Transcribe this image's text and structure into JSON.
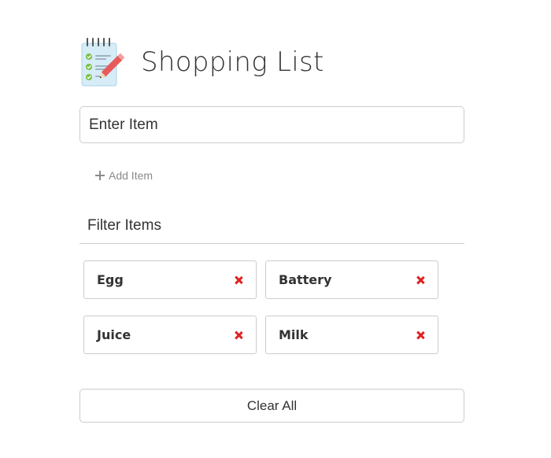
{
  "app": {
    "title": "Shopping List",
    "logo_icon": "notepad-checklist-icon"
  },
  "form": {
    "item_placeholder": "Enter Item",
    "add_label": "Add Item",
    "add_icon": "plus-icon"
  },
  "filter": {
    "placeholder": "Filter Items"
  },
  "items": [
    {
      "name": "Egg",
      "remove_icon": "close-icon"
    },
    {
      "name": "Battery",
      "remove_icon": "close-icon"
    },
    {
      "name": "Juice",
      "remove_icon": "close-icon"
    },
    {
      "name": "Milk",
      "remove_icon": "close-icon"
    }
  ],
  "clear_label": "Clear All",
  "colors": {
    "text": "#333333",
    "border": "#cccccc",
    "muted": "#8a8a8a",
    "remove": "#e02020"
  }
}
